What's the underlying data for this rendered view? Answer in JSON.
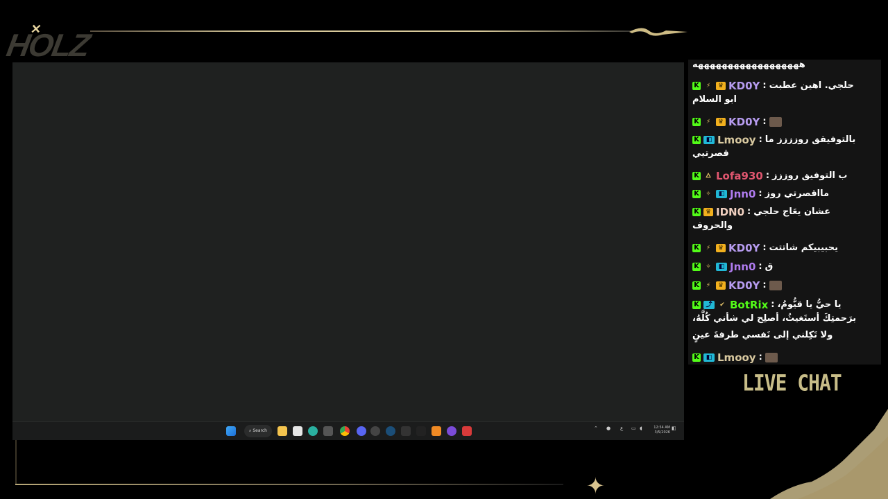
{
  "overlay": {
    "logo_text": "HOLZ",
    "live_chat_label": "LIVE CHAT"
  },
  "taskbar": {
    "search_label": "Search",
    "clock_time": "12:54 AM",
    "clock_date": "3/5/2026",
    "lang_indicator": "ع"
  },
  "chat": {
    "top_partial": "ههههههههههههههههههه",
    "messages": [
      {
        "user": "KD0Y",
        "color": "#b79cf0",
        "badges": [
          "bolt",
          "crown"
        ],
        "text": "حلجي. اهين عطبت",
        "line2": "ابو السلام"
      },
      {
        "user": "KD0Y",
        "color": "#b79cf0",
        "badges": [
          "bolt",
          "crown"
        ],
        "text": "",
        "emote": true
      },
      {
        "user": "Lmooy",
        "color": "#d9c9a0",
        "badges": [
          "dual"
        ],
        "text": "بالتوفيقق روزززز ما",
        "line2": "قصرتيي"
      },
      {
        "user": "Lofa930",
        "color": "#e0566f",
        "badges": [
          "flame"
        ],
        "text": "ب التوفيق روززز"
      },
      {
        "user": "Jnn0",
        "color": "#b07cf0",
        "badges": [
          "sparkle",
          "dual"
        ],
        "text": "مااقصرتي روز"
      },
      {
        "user": "IDN0",
        "color": "#f0d0c0",
        "badges": [
          "crown"
        ],
        "text": "عشان يعَاج حلجي",
        "line2": "والحروف"
      },
      {
        "user": "KD0Y",
        "color": "#b79cf0",
        "badges": [
          "bolt",
          "crown"
        ],
        "text": "يحبيبيكم شاتتت"
      },
      {
        "user": "Jnn0",
        "color": "#b07cf0",
        "badges": [
          "sparkle",
          "dual"
        ],
        "text": "ق"
      },
      {
        "user": "KD0Y",
        "color": "#b79cf0",
        "badges": [
          "bolt",
          "crown"
        ],
        "text": "",
        "emote": true
      },
      {
        "user": "BotRix",
        "color": "#53fc18",
        "badges": [
          "bot",
          "verified"
        ],
        "text": "يا حيُّ يا قيُّومُ،",
        "line2": "برَحمتِكَ أستَغيثُ، أصلِح لي شأني كُلَّهُ،",
        "line3": "ولا تَكِلني إلى نَفسي طرفةَ عينٍ"
      },
      {
        "user": "Lmooy",
        "color": "#d9c9a0",
        "badges": [
          "dual"
        ],
        "text": "",
        "emote": true
      }
    ]
  },
  "colors": {
    "gold": "#d8c99a",
    "kick_green": "#53fc18",
    "screen_bg": "#1f2120",
    "chat_bg": "#141414"
  }
}
